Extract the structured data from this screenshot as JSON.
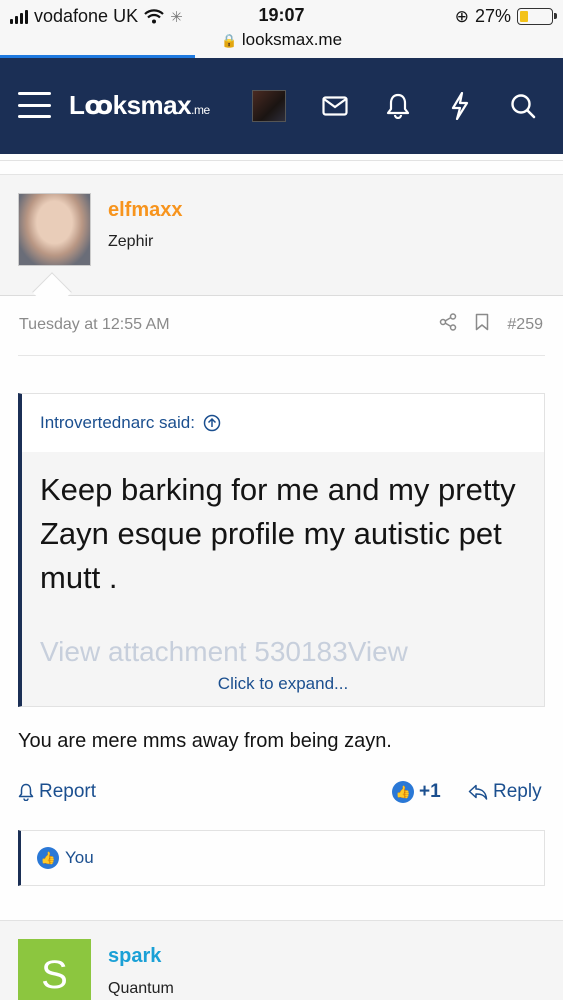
{
  "status_bar": {
    "carrier": "vodafone UK",
    "time": "19:07",
    "url": "looksmax.me",
    "battery": "27%"
  },
  "nav": {
    "logo_main": "Lꝏksmax",
    "logo_suffix": ".me"
  },
  "post": {
    "username": "elfmaxx",
    "user_title": "Zephir",
    "timestamp": "Tuesday at 12:55 AM",
    "post_number": "#259",
    "quote": {
      "author": "Introvertednarc said:",
      "text": "Keep barking for me and my pretty Zayn esque profile my autistic pet mutt .",
      "faded_text": "View attachment 530183View",
      "expand_label": "Click to expand..."
    },
    "reply_text": "You are mere mms away from being zayn.",
    "actions": {
      "report": "Report",
      "like_count": "+1",
      "reply": "Reply"
    },
    "likes_by": "You"
  },
  "next_post": {
    "avatar_letter": "S",
    "username": "spark",
    "user_title": "Quantum"
  },
  "colors": {
    "navbar": "#1b2f55",
    "username_orange": "#f7941d",
    "link_blue": "#1b4f8f",
    "username_cyan": "#1aa0d6",
    "avatar_green": "#8cc63f"
  }
}
